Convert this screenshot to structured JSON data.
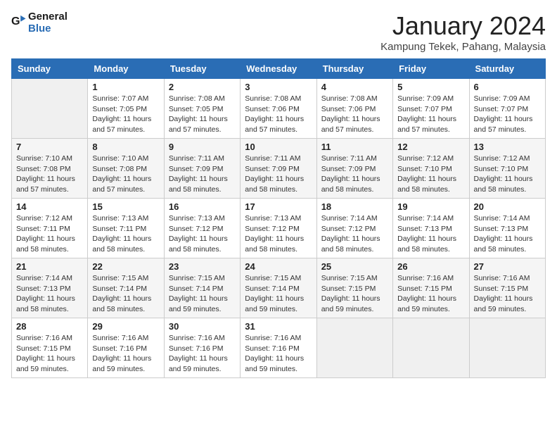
{
  "header": {
    "logo_general": "General",
    "logo_blue": "Blue",
    "title": "January 2024",
    "subtitle": "Kampung Tekek, Pahang, Malaysia"
  },
  "days_of_week": [
    "Sunday",
    "Monday",
    "Tuesday",
    "Wednesday",
    "Thursday",
    "Friday",
    "Saturday"
  ],
  "weeks": [
    [
      null,
      {
        "day": 1,
        "sunrise": "7:07 AM",
        "sunset": "7:05 PM",
        "daylight": "11 hours and 57 minutes."
      },
      {
        "day": 2,
        "sunrise": "7:08 AM",
        "sunset": "7:05 PM",
        "daylight": "11 hours and 57 minutes."
      },
      {
        "day": 3,
        "sunrise": "7:08 AM",
        "sunset": "7:06 PM",
        "daylight": "11 hours and 57 minutes."
      },
      {
        "day": 4,
        "sunrise": "7:08 AM",
        "sunset": "7:06 PM",
        "daylight": "11 hours and 57 minutes."
      },
      {
        "day": 5,
        "sunrise": "7:09 AM",
        "sunset": "7:07 PM",
        "daylight": "11 hours and 57 minutes."
      },
      {
        "day": 6,
        "sunrise": "7:09 AM",
        "sunset": "7:07 PM",
        "daylight": "11 hours and 57 minutes."
      }
    ],
    [
      {
        "day": 7,
        "sunrise": "7:10 AM",
        "sunset": "7:08 PM",
        "daylight": "11 hours and 57 minutes."
      },
      {
        "day": 8,
        "sunrise": "7:10 AM",
        "sunset": "7:08 PM",
        "daylight": "11 hours and 57 minutes."
      },
      {
        "day": 9,
        "sunrise": "7:11 AM",
        "sunset": "7:09 PM",
        "daylight": "11 hours and 58 minutes."
      },
      {
        "day": 10,
        "sunrise": "7:11 AM",
        "sunset": "7:09 PM",
        "daylight": "11 hours and 58 minutes."
      },
      {
        "day": 11,
        "sunrise": "7:11 AM",
        "sunset": "7:09 PM",
        "daylight": "11 hours and 58 minutes."
      },
      {
        "day": 12,
        "sunrise": "7:12 AM",
        "sunset": "7:10 PM",
        "daylight": "11 hours and 58 minutes."
      },
      {
        "day": 13,
        "sunrise": "7:12 AM",
        "sunset": "7:10 PM",
        "daylight": "11 hours and 58 minutes."
      }
    ],
    [
      {
        "day": 14,
        "sunrise": "7:12 AM",
        "sunset": "7:11 PM",
        "daylight": "11 hours and 58 minutes."
      },
      {
        "day": 15,
        "sunrise": "7:13 AM",
        "sunset": "7:11 PM",
        "daylight": "11 hours and 58 minutes."
      },
      {
        "day": 16,
        "sunrise": "7:13 AM",
        "sunset": "7:12 PM",
        "daylight": "11 hours and 58 minutes."
      },
      {
        "day": 17,
        "sunrise": "7:13 AM",
        "sunset": "7:12 PM",
        "daylight": "11 hours and 58 minutes."
      },
      {
        "day": 18,
        "sunrise": "7:14 AM",
        "sunset": "7:12 PM",
        "daylight": "11 hours and 58 minutes."
      },
      {
        "day": 19,
        "sunrise": "7:14 AM",
        "sunset": "7:13 PM",
        "daylight": "11 hours and 58 minutes."
      },
      {
        "day": 20,
        "sunrise": "7:14 AM",
        "sunset": "7:13 PM",
        "daylight": "11 hours and 58 minutes."
      }
    ],
    [
      {
        "day": 21,
        "sunrise": "7:14 AM",
        "sunset": "7:13 PM",
        "daylight": "11 hours and 58 minutes."
      },
      {
        "day": 22,
        "sunrise": "7:15 AM",
        "sunset": "7:14 PM",
        "daylight": "11 hours and 58 minutes."
      },
      {
        "day": 23,
        "sunrise": "7:15 AM",
        "sunset": "7:14 PM",
        "daylight": "11 hours and 59 minutes."
      },
      {
        "day": 24,
        "sunrise": "7:15 AM",
        "sunset": "7:14 PM",
        "daylight": "11 hours and 59 minutes."
      },
      {
        "day": 25,
        "sunrise": "7:15 AM",
        "sunset": "7:15 PM",
        "daylight": "11 hours and 59 minutes."
      },
      {
        "day": 26,
        "sunrise": "7:16 AM",
        "sunset": "7:15 PM",
        "daylight": "11 hours and 59 minutes."
      },
      {
        "day": 27,
        "sunrise": "7:16 AM",
        "sunset": "7:15 PM",
        "daylight": "11 hours and 59 minutes."
      }
    ],
    [
      {
        "day": 28,
        "sunrise": "7:16 AM",
        "sunset": "7:15 PM",
        "daylight": "11 hours and 59 minutes."
      },
      {
        "day": 29,
        "sunrise": "7:16 AM",
        "sunset": "7:16 PM",
        "daylight": "11 hours and 59 minutes."
      },
      {
        "day": 30,
        "sunrise": "7:16 AM",
        "sunset": "7:16 PM",
        "daylight": "11 hours and 59 minutes."
      },
      {
        "day": 31,
        "sunrise": "7:16 AM",
        "sunset": "7:16 PM",
        "daylight": "11 hours and 59 minutes."
      },
      null,
      null,
      null
    ]
  ]
}
